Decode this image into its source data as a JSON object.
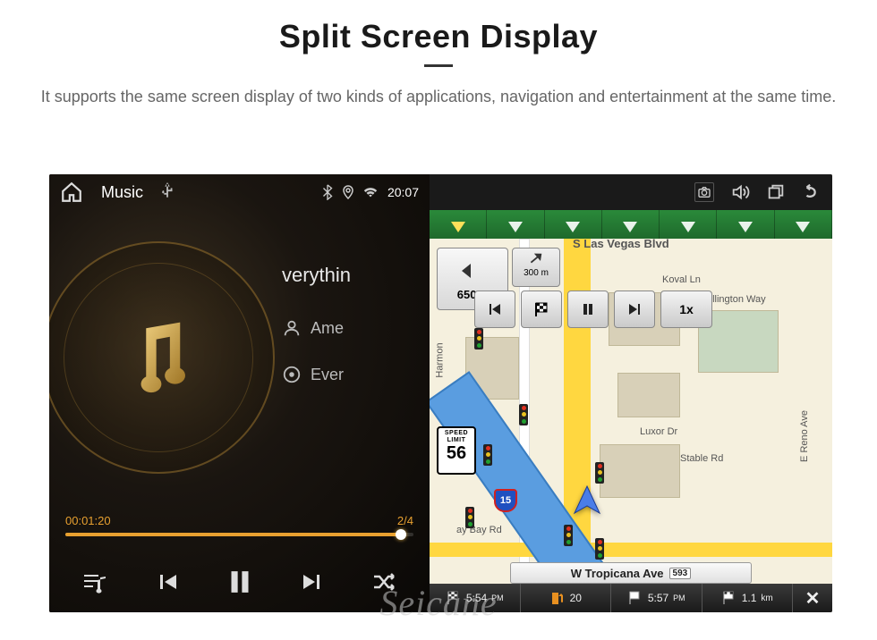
{
  "header": {
    "title": "Split Screen Display",
    "subtitle": "It supports the same screen display of two kinds of applications, navigation and entertainment at the same time."
  },
  "status_bar": {
    "music_label": "Music",
    "time": "20:07"
  },
  "music": {
    "track_title": "verythin",
    "artist": "Ame",
    "album": "Ever",
    "track_counter": "2/4",
    "elapsed": "00:01:20"
  },
  "nav": {
    "top_street": "S Las Vegas Blvd",
    "bottom_street": "W Tropicana Ave",
    "bottom_route": "593",
    "turn_distance": "650",
    "turn_unit": "m",
    "next_turn_distance": "300",
    "next_turn_unit": "m",
    "speed_limit_label1": "SPEED",
    "speed_limit_label2": "LIMIT",
    "speed_limit_value": "56",
    "speed_playback": "1x",
    "streets": {
      "koval": "Koval Ln",
      "ellington": "Duke Ellington Way",
      "harmon": "Harmon",
      "luxor": "Luxor Dr",
      "stable": "Stable Rd",
      "reno": "E Reno Ave",
      "mandalay": "ay Bay Rd"
    },
    "bottom_bar": {
      "time": "5:54",
      "fuel": "20",
      "alt_time": "5:57",
      "distance": "1.1",
      "distance_unit": "km"
    },
    "interstate": "15"
  },
  "watermark": "Seicane"
}
